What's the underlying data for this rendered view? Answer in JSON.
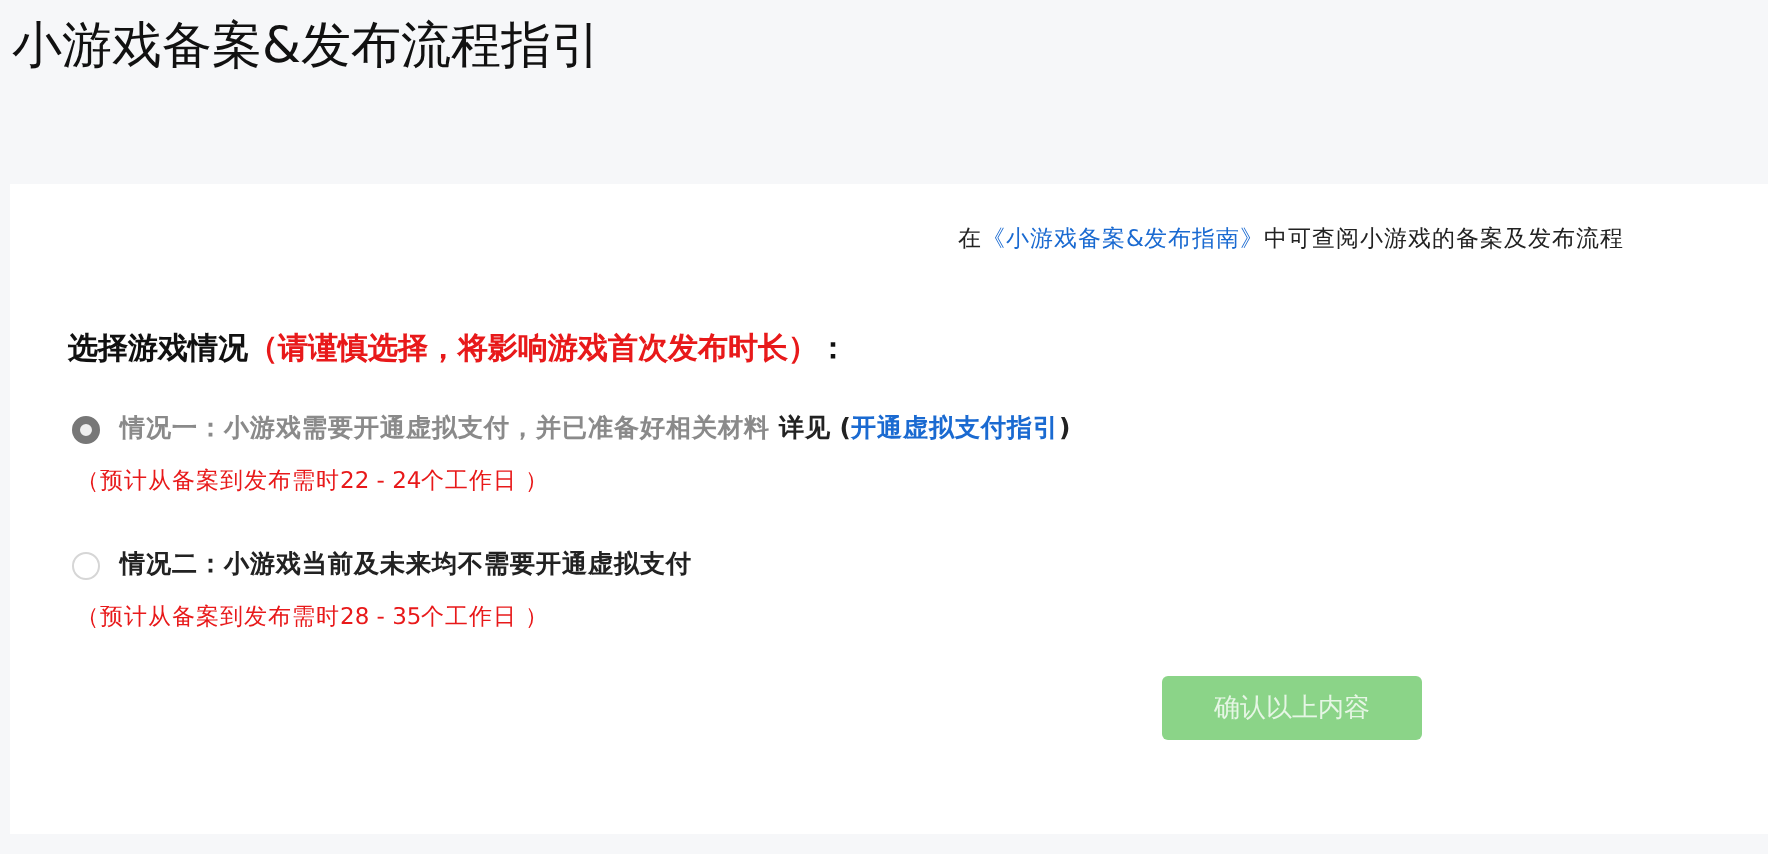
{
  "page": {
    "title": "小游戏备案&发布流程指引"
  },
  "info": {
    "before": "在",
    "link": "《小游戏备案&发布指南》",
    "after": "中可查阅小游戏的备案及发布流程"
  },
  "heading": {
    "text": "选择游戏情况",
    "warning": "（请谨慎选择，将影响游戏首次发布时长）",
    "suffix": "："
  },
  "options": [
    {
      "label": "情况一：小游戏需要开通虚拟支付，并已准备好相关材料",
      "selected": true,
      "disabled": true,
      "detail": "详见",
      "open": "(",
      "link": "开通虚拟支付指引",
      "close": ")",
      "note": "（预计从备案到发布需时22 - 24个工作日 ）"
    },
    {
      "label": "情况二：小游戏当前及未来均不需要开通虚拟支付",
      "selected": false,
      "disabled": false,
      "note": "（预计从备案到发布需时28 - 35个工作日 ）"
    }
  ],
  "confirm": {
    "label": "确认以上内容",
    "disabled": true
  }
}
